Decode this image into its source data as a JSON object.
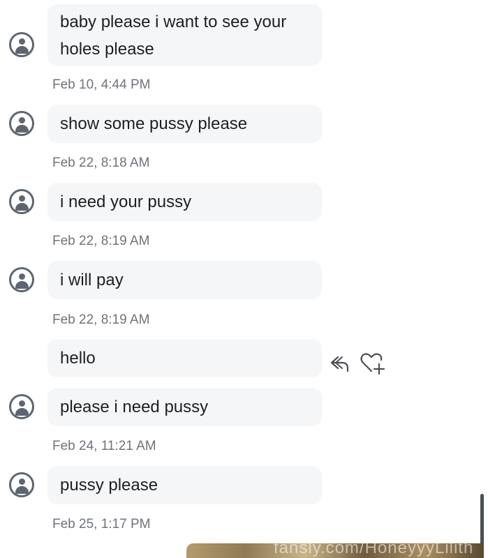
{
  "messages": [
    {
      "text_lines": [
        "baby please i want to see your",
        "holes please"
      ],
      "timestamp": "Feb 10, 4:44 PM"
    },
    {
      "text": "show some pussy please",
      "timestamp": "Feb 22, 8:18 AM"
    },
    {
      "text": "i need your pussy",
      "timestamp": "Feb 22, 8:19 AM"
    },
    {
      "text": "i will pay",
      "timestamp": "Feb 22, 8:19 AM"
    },
    {
      "text": "hello"
    },
    {
      "text": "please i need pussy",
      "timestamp": "Feb 24, 11:21 AM"
    },
    {
      "text": "pussy please",
      "timestamp": "Feb 25, 1:17 PM"
    }
  ],
  "actions": {
    "reply_icon": "reply-icon",
    "react_icon": "heart-plus-icon"
  },
  "watermark": "fansly.com/HoneyyyLilith",
  "colors": {
    "bubble": "#f5f6f8",
    "text": "#1d1f22",
    "timestamp": "#6e747b",
    "icon": "#5d6670"
  }
}
